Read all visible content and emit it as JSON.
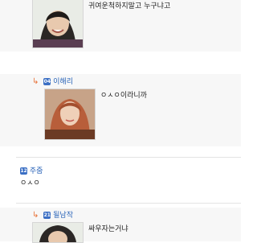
{
  "comments": [
    {
      "nickname": "",
      "text": "귀여운척하지말고 누구냐고"
    },
    {
      "nickname": "이해리",
      "text": "ㅇㅅㅇ이라니까"
    },
    {
      "nickname": "주줌",
      "text": "ㅇㅅㅇ"
    },
    {
      "nickname": "될남작",
      "text": "싸우자는거냐"
    }
  ],
  "level_icons": [
    "04",
    "12",
    "21"
  ],
  "reply_arrow": "↳",
  "colors": {
    "nick": "#2a64b8",
    "arrow": "#e8733a",
    "reply_bg": "#f7f7f7"
  }
}
